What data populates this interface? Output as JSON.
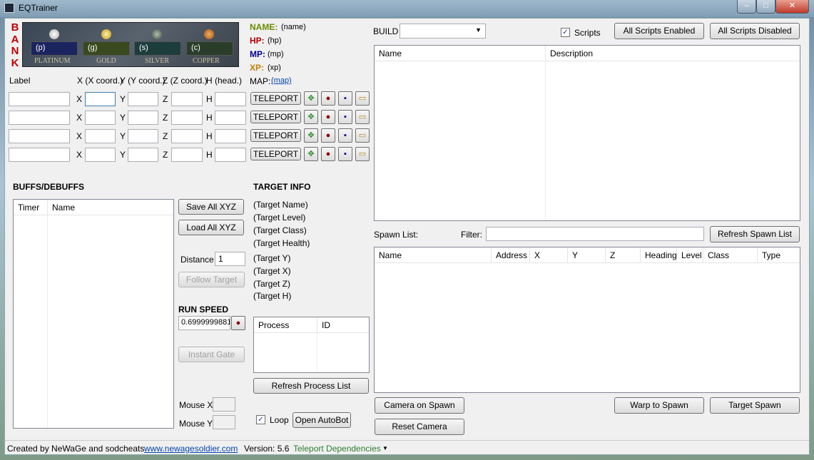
{
  "window": {
    "title": "EQTrainer",
    "min": "–",
    "max": "□",
    "close": "✕"
  },
  "bank": {
    "letters": [
      "B",
      "A",
      "N",
      "K"
    ],
    "coins": [
      {
        "value": "(p)",
        "label": "PLATINUM",
        "color": "#d8d8d8"
      },
      {
        "value": "(g)",
        "label": "GOLD",
        "color": "#e0c040"
      },
      {
        "value": "(s)",
        "label": "SILVER",
        "color": "#708070"
      },
      {
        "value": "(c)",
        "label": "COPPER",
        "color": "#d08030"
      }
    ]
  },
  "stats": {
    "name_label": "NAME:",
    "name_value": "(name)",
    "hp_label": "HP:",
    "hp_value": "(hp)",
    "mp_label": "MP:",
    "mp_value": "(mp)",
    "xp_label": "XP:",
    "xp_value": "(xp)",
    "map_label": "MAP:",
    "map_value": "(map)"
  },
  "coords": {
    "label": "Label",
    "x": "X (X coord.)",
    "y": "Y (Y coord.)",
    "z": "Z (Z coord.)",
    "h": "H (head.)",
    "xs": "X",
    "ys": "Y",
    "zs": "Z",
    "hs": "H",
    "teleport": "TELEPORT"
  },
  "buffs": {
    "title": "BUFFS/DEBUFFS",
    "cols": [
      "Timer",
      "Name"
    ]
  },
  "controls": {
    "save_all": "Save All XYZ",
    "load_all": "Load All XYZ",
    "distance_label": "Distance",
    "distance_value": "1",
    "follow": "Follow Target",
    "run_speed_title": "RUN SPEED",
    "run_speed_value": "0.6999999881",
    "instant_gate": "Instant Gate",
    "mouse_x": "Mouse X",
    "mouse_y": "Mouse Y"
  },
  "target": {
    "title": "TARGET INFO",
    "name": "(Target Name)",
    "level": "(Target Level)",
    "class": "(Target Class)",
    "health": "(Target Health)",
    "y": "(Target Y)",
    "x": "(Target X)",
    "z": "(Target Z)",
    "h": "(Target H)"
  },
  "process": {
    "cols": [
      "Process",
      "ID"
    ],
    "refresh": "Refresh Process List",
    "loop": "Loop",
    "autobot": "Open AutoBot"
  },
  "build": {
    "label": "BUILD",
    "scripts_label": "Scripts",
    "enabled": "All Scripts Enabled",
    "disabled": "All Scripts Disabled",
    "cols": [
      "Name",
      "Description"
    ]
  },
  "spawn": {
    "label": "Spawn List:",
    "filter": "Filter:",
    "refresh": "Refresh Spawn List",
    "cols": [
      "Name",
      "Address",
      "X",
      "Y",
      "Z",
      "Heading",
      "Level",
      "Class",
      "Type"
    ],
    "camera_on": "Camera on Spawn",
    "reset_camera": "Reset Camera",
    "warp": "Warp to Spawn",
    "target": "Target Spawn"
  },
  "status": {
    "credit": "Created by NeWaGe and sodcheats",
    "link": "www.newagesoldier.com",
    "version": "Version: 5.6",
    "deps": "Teleport Dependencies"
  }
}
